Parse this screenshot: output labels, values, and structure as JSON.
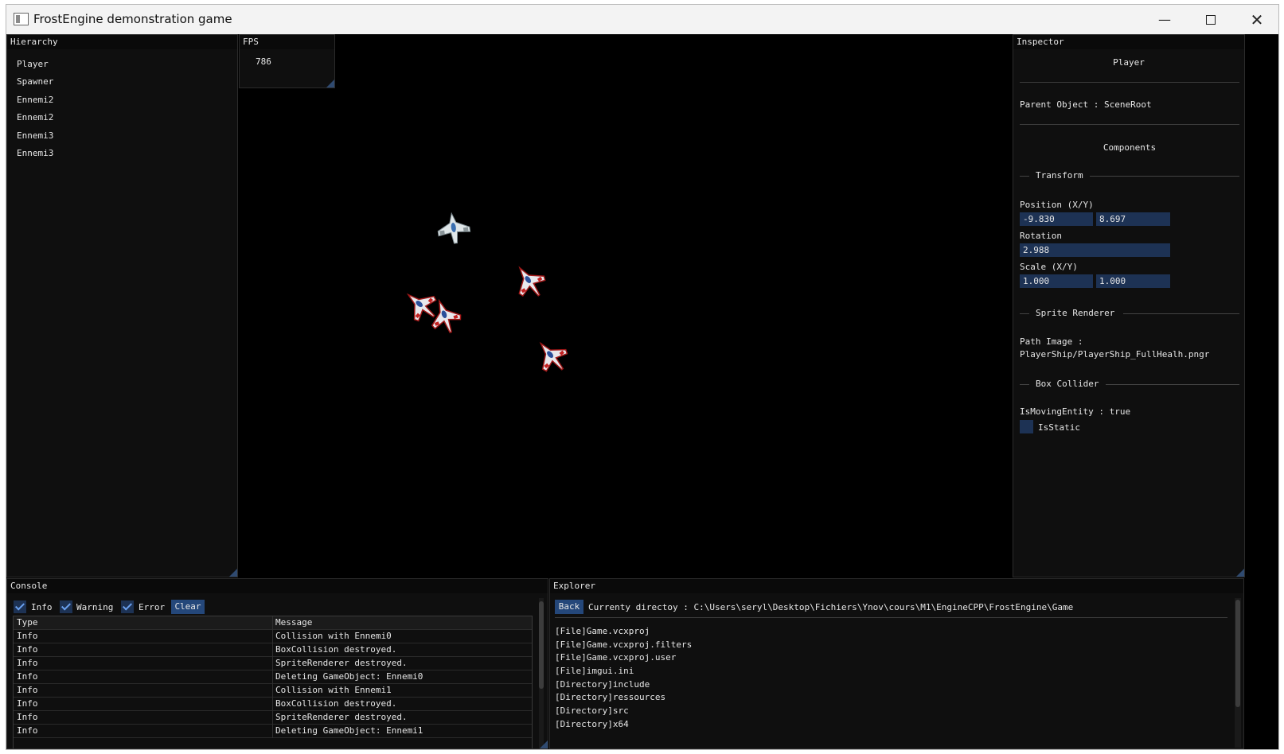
{
  "window": {
    "title": "FrostEngine demonstration game",
    "controls": {
      "minimize": "—",
      "close": "✕"
    }
  },
  "hierarchy": {
    "title": "Hierarchy",
    "items": [
      "Player",
      "Spawner",
      "Ennemi2",
      "Ennemi2",
      "Ennemi3",
      "Ennemi3"
    ]
  },
  "fps": {
    "title": "FPS",
    "value": "786"
  },
  "viewport": {
    "sprites": [
      "player-ship",
      "enemy-ship",
      "enemy-ship",
      "enemy-ship",
      "enemy-ship"
    ]
  },
  "inspector": {
    "title": "Inspector",
    "object_name": "Player",
    "parent": "Parent Object : SceneRoot",
    "components_label": "Components",
    "transform": {
      "header": "Transform",
      "position_label": "Position (X/Y)",
      "position_x": "-9.830",
      "position_y": "8.697",
      "rotation_label": "Rotation",
      "rotation": "2.988",
      "scale_label": "Scale (X/Y)",
      "scale_x": "1.000",
      "scale_y": "1.000"
    },
    "sprite_renderer": {
      "header": "Sprite Renderer",
      "path_label": "Path Image :",
      "path_value": "PlayerShip/PlayerShip_FullHealh.pngr"
    },
    "box_collider": {
      "header": "Box Collider",
      "moving": "IsMovingEntity : true",
      "static_label": "IsStatic"
    }
  },
  "console": {
    "title": "Console",
    "filters": {
      "info": "Info",
      "warning": "Warning",
      "error": "Error"
    },
    "clear_label": "Clear",
    "columns": [
      "Type",
      "Message"
    ],
    "rows": [
      [
        "Info",
        "Collision with Ennemi0"
      ],
      [
        "Info",
        "BoxCollision destroyed."
      ],
      [
        "Info",
        "SpriteRenderer destroyed."
      ],
      [
        "Info",
        "Deleting GameObject: Ennemi0"
      ],
      [
        "Info",
        "Collision with Ennemi1"
      ],
      [
        "Info",
        "BoxCollision destroyed."
      ],
      [
        "Info",
        "SpriteRenderer destroyed."
      ],
      [
        "Info",
        "Deleting GameObject: Ennemi1"
      ]
    ]
  },
  "explorer": {
    "title": "Explorer",
    "back_label": "Back",
    "current_dir": "Currenty directoy : C:\\Users\\seryl\\Desktop\\Fichiers\\Ynov\\cours\\M1\\EngineCPP\\FrostEngine\\Game",
    "items": [
      "[File]Game.vcxproj",
      "[File]Game.vcxproj.filters",
      "[File]Game.vcxproj.user",
      "[File]imgui.ini",
      "[Directory]include",
      "[Directory]ressources",
      "[Directory]src",
      "[Directory]x64"
    ]
  },
  "colors": {
    "panel_bg": "#0f0f0f",
    "field_bg": "#1d3254",
    "button_bg": "#24477a",
    "check_mark": "#6aa0ee",
    "text": "#e6e6e6"
  }
}
